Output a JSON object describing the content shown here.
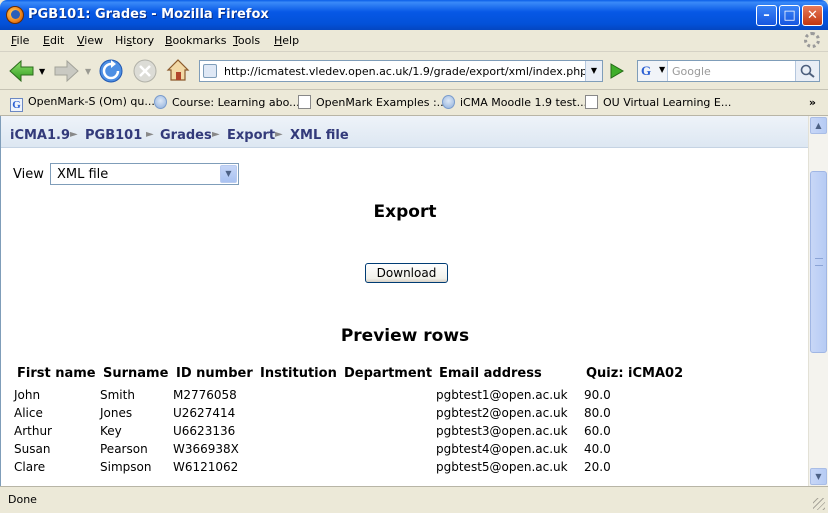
{
  "window": {
    "title": "PGB101: Grades - Mozilla Firefox"
  },
  "menu": {
    "items": [
      {
        "key": "F",
        "rest": "ile"
      },
      {
        "key": "E",
        "rest": "dit"
      },
      {
        "key": "V",
        "rest": "iew"
      },
      {
        "pre": "Hi",
        "key": "s",
        "rest": "tory"
      },
      {
        "key": "B",
        "rest": "ookmarks"
      },
      {
        "key": "T",
        "rest": "ools"
      },
      {
        "key": "H",
        "rest": "elp"
      }
    ]
  },
  "nav": {
    "url": "http://icmatest.vledev.open.ac.uk/1.9/grade/export/xml/index.php",
    "search_placeholder": "Google"
  },
  "bookmarks": [
    {
      "label": "OpenMark-S (Om) qu...",
      "icon": "google-icon"
    },
    {
      "label": "Course: Learning abo...",
      "icon": "moodle-icon"
    },
    {
      "label": "OpenMark Examples :...",
      "icon": "page-icon"
    },
    {
      "label": "iCMA Moodle 1.9 test...",
      "icon": "moodle-icon"
    },
    {
      "label": "OU Virtual Learning E...",
      "icon": "page-icon"
    }
  ],
  "breadcrumb": [
    "iCMA1.9",
    "PGB101",
    "Grades",
    "Export",
    "XML file"
  ],
  "view": {
    "label": "View",
    "selected": "XML file"
  },
  "export": {
    "heading": "Export",
    "download_label": "Download"
  },
  "preview": {
    "heading": "Preview rows",
    "columns": [
      "First name",
      "Surname",
      "ID number",
      "Institution",
      "Department",
      "Email address",
      "Quiz: iCMA02"
    ],
    "rows": [
      [
        "John",
        "Smith",
        "M2776058",
        "",
        "",
        "pgbtest1@open.ac.uk",
        "90.0"
      ],
      [
        "Alice",
        "Jones",
        "U2627414",
        "",
        "",
        "pgbtest2@open.ac.uk",
        "80.0"
      ],
      [
        "Arthur",
        "Key",
        "U6623136",
        "",
        "",
        "pgbtest3@open.ac.uk",
        "60.0"
      ],
      [
        "Susan",
        "Pearson",
        "W366938X",
        "",
        "",
        "pgbtest4@open.ac.uk",
        "40.0"
      ],
      [
        "Clare",
        "Simpson",
        "W6121062",
        "",
        "",
        "pgbtest5@open.ac.uk",
        "20.0"
      ]
    ]
  },
  "status": {
    "text": "Done"
  }
}
